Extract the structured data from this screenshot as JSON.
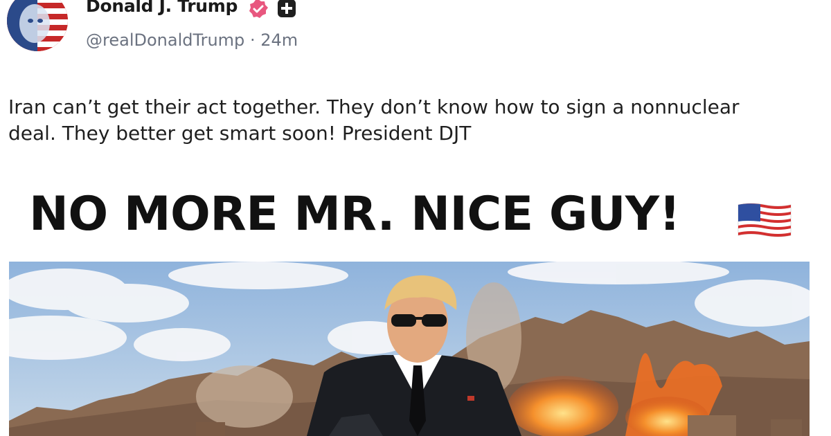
{
  "author": {
    "display_name": "Donald J. Trump",
    "handle": "@realDonaldTrump",
    "separator": "·",
    "timestamp": "24m",
    "avatar_icon": "flag-portrait-avatar",
    "verified_icon": "verified-badge-icon",
    "badge_icon": "plus-icon"
  },
  "post": {
    "text": "Iran can’t get their act together. They don’t know how to sign a nonnuclear deal. They better get smart soon! President DJT"
  },
  "image": {
    "headline": "NO MORE MR. NICE GUY!",
    "headline_icon": "us-flag-icon"
  },
  "colors": {
    "verified": "#e8577f",
    "text": "#1f1f1f",
    "secondary_text": "#6b7280",
    "sky": "#a9c6e4",
    "mountain": "#8a6a52",
    "explosion": "#f07a22"
  }
}
